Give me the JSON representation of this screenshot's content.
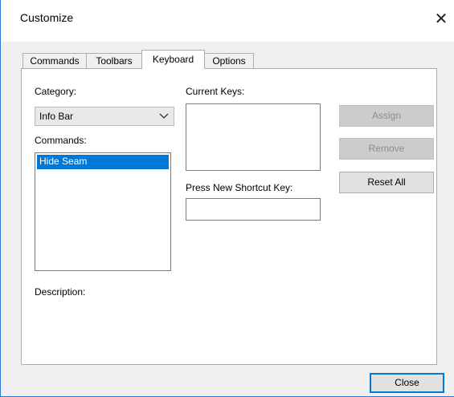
{
  "window": {
    "title": "Customize",
    "close_glyph": "✕"
  },
  "tabs": [
    {
      "label": "Commands"
    },
    {
      "label": "Toolbars"
    },
    {
      "label": "Keyboard"
    },
    {
      "label": "Options"
    }
  ],
  "active_tab": "Keyboard",
  "keyboard": {
    "category_label": "Category:",
    "category_value": "Info Bar",
    "commands_label": "Commands:",
    "commands": [
      "Hide Seam"
    ],
    "selected_command": "Hide Seam",
    "description_label": "Description:",
    "current_keys_label": "Current Keys:",
    "new_shortcut_label": "Press New Shortcut Key:",
    "new_shortcut_value": ""
  },
  "buttons": {
    "assign": "Assign",
    "remove": "Remove",
    "reset_all": "Reset All",
    "close": "Close"
  },
  "colors": {
    "selection": "#0078d7",
    "window_border": "#2b79d6",
    "disabled_button": "#cccccc"
  }
}
